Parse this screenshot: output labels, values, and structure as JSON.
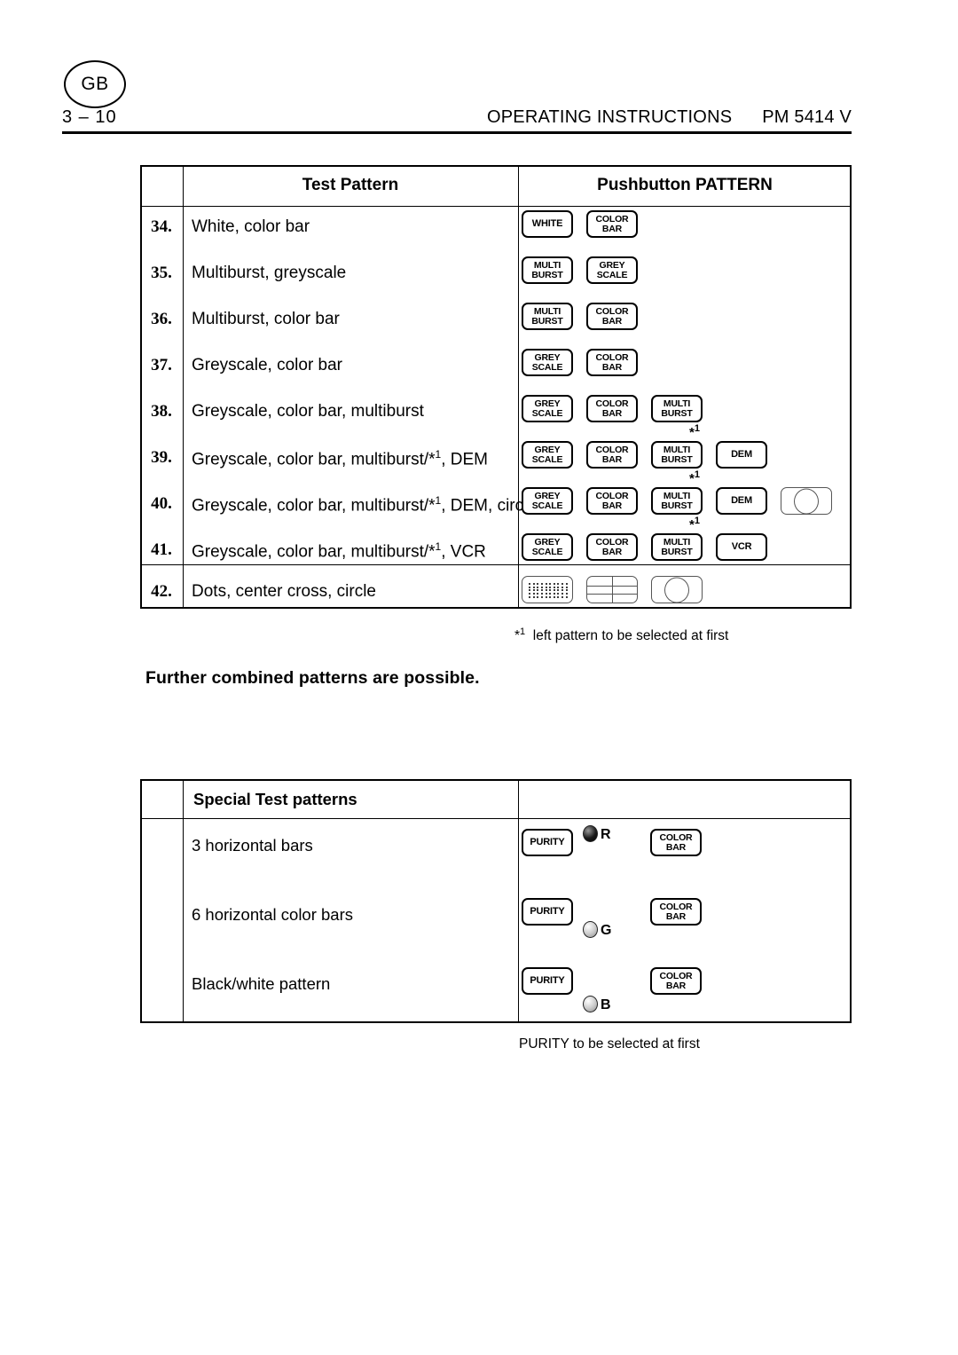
{
  "header": {
    "region_badge": "GB",
    "page_number": "3 – 10",
    "title": "OPERATING INSTRUCTIONS",
    "model": "PM 5414 V"
  },
  "main_table": {
    "columns": {
      "number": "",
      "test_pattern": "Test Pattern",
      "pushbutton": "Pushbutton PATTERN"
    },
    "rows": [
      {
        "num": "34.",
        "label": "White, color bar"
      },
      {
        "num": "35.",
        "label": "Multiburst, greyscale"
      },
      {
        "num": "36.",
        "label": "Multiburst, color bar"
      },
      {
        "num": "37.",
        "label": "Greyscale, color bar"
      },
      {
        "num": "38.",
        "label": "Greyscale, color bar, multiburst"
      },
      {
        "num": "39.",
        "label_pre": "Greyscale, color bar, multiburst/*",
        "label_sup": "1",
        "label_post": ", DEM"
      },
      {
        "num": "40.",
        "label_pre": "Greyscale, color bar, multiburst/*",
        "label_sup": "1",
        "label_post": ", DEM, circle"
      },
      {
        "num": "41.",
        "label_pre": "Greyscale, color bar, multiburst/*",
        "label_sup": "1",
        "label_post": ", VCR"
      },
      {
        "num": "42.",
        "label": "Dots, center cross, circle"
      }
    ],
    "buttons": {
      "white": "WHITE",
      "color_top": "COLOR",
      "color_bottom": "BAR",
      "multi_top": "MULTI",
      "multi_bottom": "BURST",
      "grey_top": "GREY",
      "grey_bottom": "SCALE",
      "dem": "DEM",
      "vcr": "VCR"
    },
    "star_marker": "*",
    "star_marker_sup": "1"
  },
  "footnote_main": {
    "marker": "*",
    "marker_sup": "1",
    "text": "left pattern to be selected at first"
  },
  "further_note": "Further combined patterns are possible.",
  "special_table": {
    "title": "Special Test patterns",
    "rows": [
      {
        "label": "3 horizontal bars",
        "purity": "PURITY",
        "led": "R",
        "led_state": "on",
        "color_top": "COLOR",
        "color_bottom": "BAR"
      },
      {
        "label": "6 horizontal color bars",
        "purity": "PURITY",
        "led": "G",
        "led_state": "off",
        "color_top": "COLOR",
        "color_bottom": "BAR"
      },
      {
        "label": "Black/white pattern",
        "purity": "PURITY",
        "led": "B",
        "led_state": "off",
        "color_top": "COLOR",
        "color_bottom": "BAR"
      }
    ]
  },
  "footnote_special": "PURITY to be selected at first"
}
